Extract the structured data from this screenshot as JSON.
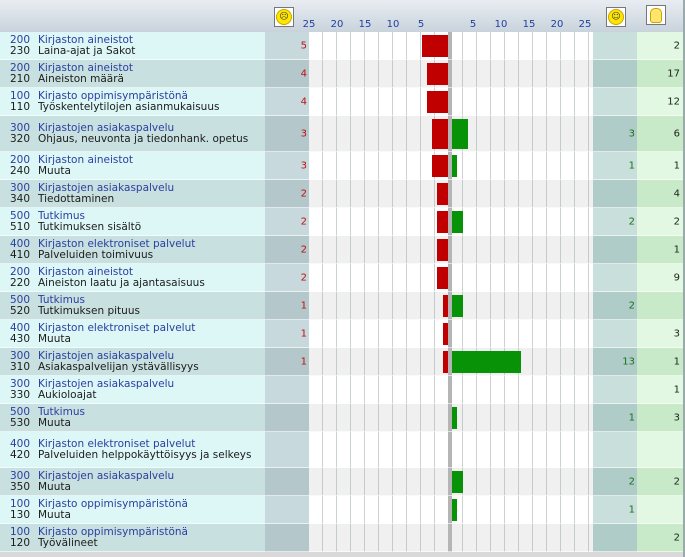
{
  "header": {
    "neg_icon": "sad-face-icon",
    "pos_icon": "happy-face-icon",
    "idea_icon": "lightbulb-icon",
    "neg_ticks": [
      "25",
      "20",
      "15",
      "10",
      "5"
    ],
    "pos_ticks": [
      "5",
      "10",
      "15",
      "20",
      "25"
    ]
  },
  "rows": [
    {
      "code1": "200",
      "cat": "Kirjaston aineistot",
      "code2": "230",
      "sub": "Laina-ajat ja Sakot",
      "neg": 5,
      "neg_label": "5",
      "pos": 0,
      "pos_label": "",
      "ideas": "2"
    },
    {
      "code1": "200",
      "cat": "Kirjaston aineistot",
      "code2": "210",
      "sub": "Aineiston määrä",
      "neg": 4,
      "neg_label": "4",
      "pos": 0,
      "pos_label": "",
      "ideas": "17"
    },
    {
      "code1": "100",
      "cat": "Kirjasto oppimisympäristönä",
      "code2": "110",
      "sub": "Työskentelytilojen asianmukaisuus",
      "neg": 4,
      "neg_label": "4",
      "pos": 0,
      "pos_label": "",
      "ideas": "12"
    },
    {
      "code1": "300",
      "cat": "Kirjastojen asiakaspalvelu",
      "code2": "320",
      "sub": "Ohjaus, neuvonta ja tiedonhank. opetus",
      "neg": 3,
      "neg_label": "3",
      "pos": 3,
      "pos_label": "3",
      "ideas": "6",
      "tall": true
    },
    {
      "code1": "200",
      "cat": "Kirjaston aineistot",
      "code2": "240",
      "sub": "Muuta",
      "neg": 3,
      "neg_label": "3",
      "pos": 1,
      "pos_label": "1",
      "ideas": "1"
    },
    {
      "code1": "300",
      "cat": "Kirjastojen asiakaspalvelu",
      "code2": "340",
      "sub": "Tiedottaminen",
      "neg": 2,
      "neg_label": "2",
      "pos": 0,
      "pos_label": "",
      "ideas": "4"
    },
    {
      "code1": "500",
      "cat": "Tutkimus",
      "code2": "510",
      "sub": "Tutkimuksen sisältö",
      "neg": 2,
      "neg_label": "2",
      "pos": 2,
      "pos_label": "2",
      "ideas": "2"
    },
    {
      "code1": "400",
      "cat": "Kirjaston elektroniset palvelut",
      "code2": "410",
      "sub": "Palveluiden toimivuus",
      "neg": 2,
      "neg_label": "2",
      "pos": 0,
      "pos_label": "",
      "ideas": "1"
    },
    {
      "code1": "200",
      "cat": "Kirjaston aineistot",
      "code2": "220",
      "sub": "Aineiston laatu ja ajantasaisuus",
      "neg": 2,
      "neg_label": "2",
      "pos": 0,
      "pos_label": "",
      "ideas": "9"
    },
    {
      "code1": "500",
      "cat": "Tutkimus",
      "code2": "520",
      "sub": "Tutkimuksen pituus",
      "neg": 1,
      "neg_label": "1",
      "pos": 2,
      "pos_label": "2",
      "ideas": ""
    },
    {
      "code1": "400",
      "cat": "Kirjaston elektroniset palvelut",
      "code2": "430",
      "sub": "Muuta",
      "neg": 1,
      "neg_label": "1",
      "pos": 0,
      "pos_label": "",
      "ideas": "3"
    },
    {
      "code1": "300",
      "cat": "Kirjastojen asiakaspalvelu",
      "code2": "310",
      "sub": "Asiakaspalvelijan ystävällisyys",
      "neg": 1,
      "neg_label": "1",
      "pos": 13,
      "pos_label": "13",
      "ideas": "1"
    },
    {
      "code1": "300",
      "cat": "Kirjastojen asiakaspalvelu",
      "code2": "330",
      "sub": "Aukioloajat",
      "neg": 0,
      "neg_label": "",
      "pos": 0,
      "pos_label": "",
      "ideas": "1"
    },
    {
      "code1": "500",
      "cat": "Tutkimus",
      "code2": "530",
      "sub": "Muuta",
      "neg": 0,
      "neg_label": "",
      "pos": 1,
      "pos_label": "1",
      "ideas": "3"
    },
    {
      "code1": "400",
      "cat": "Kirjaston elektroniset palvelut",
      "code2": "420",
      "sub": "Palveluiden helppokäyttöisyys ja selkeys",
      "neg": 0,
      "neg_label": "",
      "pos": 0,
      "pos_label": "",
      "ideas": "",
      "tall": true
    },
    {
      "code1": "300",
      "cat": "Kirjastojen asiakaspalvelu",
      "code2": "350",
      "sub": "Muuta",
      "neg": 0,
      "neg_label": "",
      "pos": 2,
      "pos_label": "2",
      "ideas": "2"
    },
    {
      "code1": "100",
      "cat": "Kirjasto oppimisympäristönä",
      "code2": "130",
      "sub": "Muuta",
      "neg": 0,
      "neg_label": "",
      "pos": 1,
      "pos_label": "1",
      "ideas": ""
    },
    {
      "code1": "100",
      "cat": "Kirjasto oppimisympäristönä",
      "code2": "120",
      "sub": "Työvälineet",
      "neg": 0,
      "neg_label": "",
      "pos": 0,
      "pos_label": "",
      "ideas": "2"
    }
  ],
  "colors": {
    "negative": "#c00000",
    "positive": "#079207"
  }
}
